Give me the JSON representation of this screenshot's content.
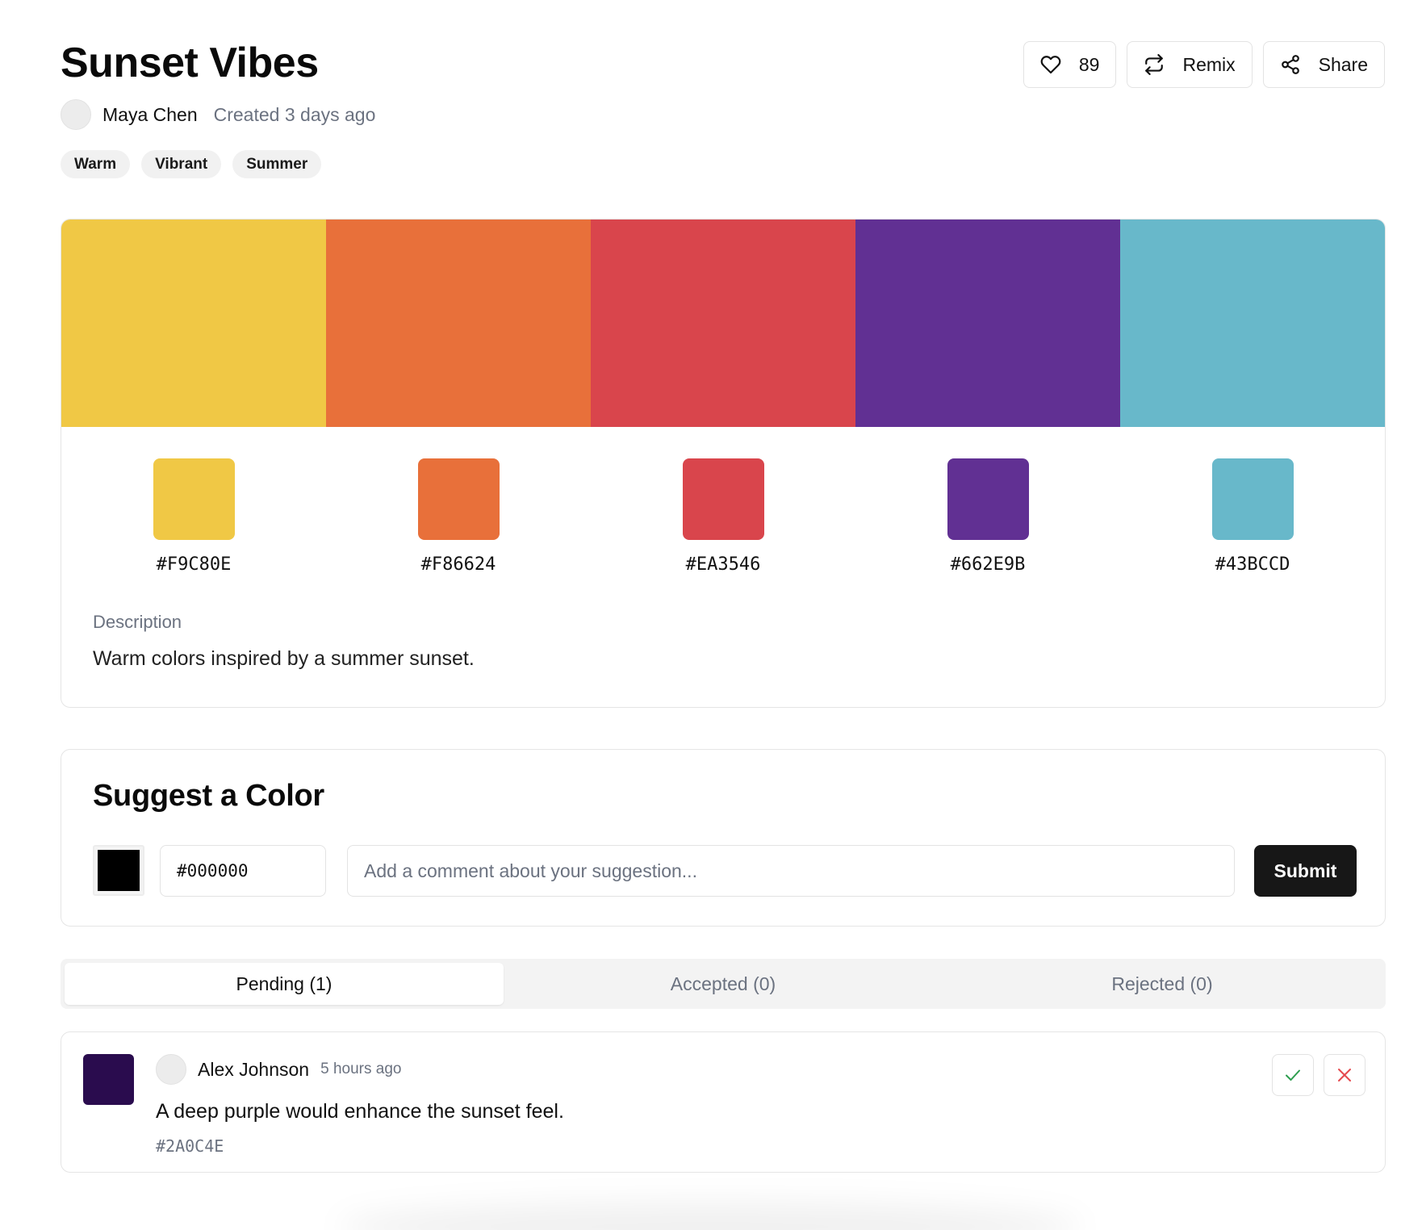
{
  "palette": {
    "title": "Sunset Vibes",
    "author": "Maya Chen",
    "created": "Created 3 days ago",
    "tags": [
      "Warm",
      "Vibrant",
      "Summer"
    ],
    "description_label": "Description",
    "description": "Warm colors inspired by a summer sunset.",
    "colors": [
      {
        "hex": "#F9C80E",
        "display": "#F0C845"
      },
      {
        "hex": "#F86624",
        "display": "#E8703A"
      },
      {
        "hex": "#EA3546",
        "display": "#D9454C"
      },
      {
        "hex": "#662E9B",
        "display": "#613093"
      },
      {
        "hex": "#43BCCD",
        "display": "#68B8CA"
      }
    ]
  },
  "actions": {
    "like_count": "89",
    "like_icon": "heart-icon",
    "remix_label": "Remix",
    "remix_icon": "repeat-icon",
    "share_label": "Share",
    "share_icon": "share-icon"
  },
  "suggest": {
    "title": "Suggest a Color",
    "picker_color": "#000000",
    "hex_value": "#000000",
    "comment_placeholder": "Add a comment about your suggestion...",
    "submit_label": "Submit"
  },
  "tabs": [
    {
      "label": "Pending (1)",
      "active": true
    },
    {
      "label": "Accepted (0)",
      "active": false
    },
    {
      "label": "Rejected (0)",
      "active": false
    }
  ],
  "suggestions": [
    {
      "user": "Alex Johnson",
      "time": "5 hours ago",
      "comment": "A deep purple would enhance the sunset feel.",
      "hex": "#2A0C4E",
      "color": "#2A0C4E",
      "accept_icon": "check-icon",
      "reject_icon": "close-icon"
    }
  ],
  "colors": {
    "accept": "#2e9e4f",
    "reject": "#e5484d",
    "primary_button": "#171717"
  }
}
